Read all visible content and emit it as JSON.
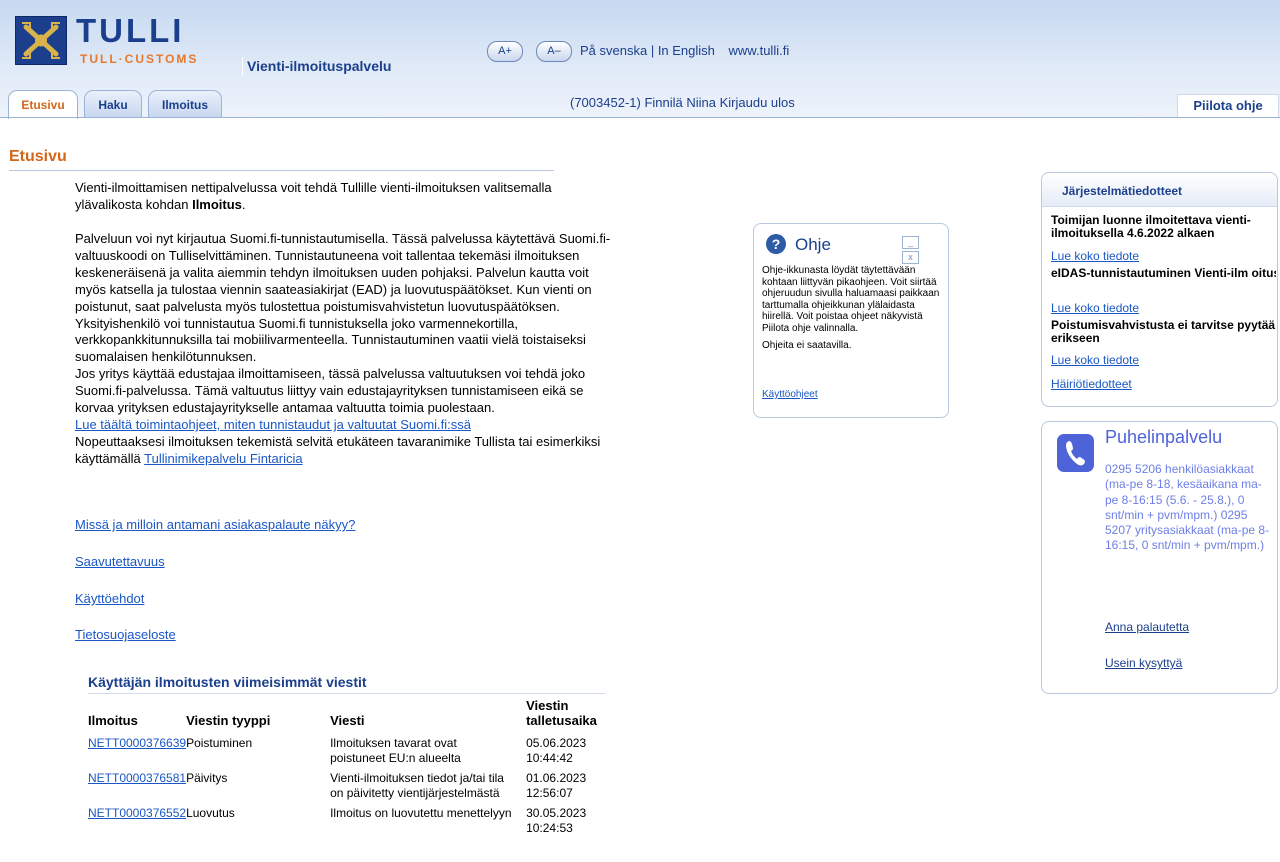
{
  "header": {
    "logo_word": "TULLI",
    "logo_sub": "TULL·CUSTOMS",
    "service_name": "Vienti-ilmoituspalvelu",
    "font_increase": "A+",
    "font_decrease": "A–",
    "lang_swedish": "På svenska",
    "lang_sep": " | ",
    "lang_english": "In English",
    "site_link": "www.tulli.fi",
    "user_info": "(7003452-1) Finnilä Niina",
    "logout": "Kirjaudu ulos",
    "hide_help": "Piilota ohje"
  },
  "tabs": [
    {
      "label": "Etusivu",
      "active": true
    },
    {
      "label": "Haku",
      "active": false
    },
    {
      "label": "Ilmoitus",
      "active": false
    }
  ],
  "main": {
    "title": "Etusivu",
    "intro_text": "Vienti-ilmoittamisen nettipalvelussa voit tehdä Tullille vienti-ilmoituksen valitsemalla ylävalikosta kohdan ",
    "intro_bold": "Ilmoitus",
    "intro_end": ".",
    "para1": "Palveluun voi nyt kirjautua Suomi.fi-tunnistautumisella. Tässä palvelussa käytettävä Suomi.fi-valtuuskoodi on Tulliselvittäminen. Tunnistautuneena voit tallentaa tekemäsi ilmoituksen keskeneräisenä ja valita aiemmin tehdyn ilmoituksen uuden pohjaksi. Palvelun kautta voit myös katsella ja tulostaa viennin saateasiakirjat (EAD) ja luovutuspäätökset. Kun vienti on poistunut, saat palvelusta myös tulostettua poistumisvahvistetun luovutuspäätöksen.",
    "para2": "Yksityishenkilö voi tunnistautua Suomi.fi tunnistuksella joko varmennekortilla, verkkopankkitunnuksilla tai mobiilivarmenteella. Tunnistautuminen vaatii vielä toistaiseksi suomalaisen henkilötunnuksen.",
    "para3": "Jos yritys käyttää edustajaa ilmoittamiseen, tässä palvelussa valtuutuksen voi tehdä joko Suomi.fi-palvelussa. Tämä valtuutus liittyy vain edustajayrityksen tunnistamiseen eikä se korvaa yrityksen edustajayritykselle antamaa valtuutta toimia puolestaan.",
    "link_instructions": "Lue täältä toimintaohjeet, miten tunnistaudut ja valtuutat Suomi.fi:ssä",
    "para4": "Nopeuttaaksesi ilmoituksen tekemistä selvitä etukäteen tavaranimike Tullista tai esimerkiksi käyttämällä ",
    "link_fintaric": "Tullinimikepalvelu Fintaricia",
    "link_feedback_visibility": "Missä ja milloin antamani asiakaspalaute näkyy?",
    "link_accessibility": "Saavutettavuus",
    "link_terms": "Käyttöehdot",
    "link_privacy": "Tietosuojaseloste"
  },
  "messages": {
    "heading": "Käyttäjän ilmoitusten viimeisimmät viestit",
    "columns": [
      "Ilmoitus",
      "Viestin tyyppi",
      "Viesti",
      "Viestin talletusaika"
    ],
    "rows": [
      {
        "id": "NETT0000376639",
        "type": "Poistuminen",
        "msg": "Ilmoituksen tavarat ovat poistuneet EU:n alueelta",
        "time": "05.06.2023 10:44:42"
      },
      {
        "id": "NETT0000376581",
        "type": "Päivitys",
        "msg": "Vienti-ilmoituksen tiedot ja/tai tila on päivitetty vientijärjestelmästä",
        "time": "01.06.2023 12:56:07"
      },
      {
        "id": "NETT0000376552",
        "type": "Luovutus",
        "msg": "Ilmoitus on luovutettu menettelyyn",
        "time": "30.05.2023 10:24:53"
      }
    ]
  },
  "help": {
    "title": "Ohje",
    "text1": "Ohje-ikkunasta löydät täytettävään kohtaan liittyvän pikaohjeen. Voit siirtää ohjeruudun sivulla haluamaasi paikkaan tarttumalla ohjeikkunan ylälaidasta hiirellä. Voit poistaa ohjeet näkyvistä Piilota ohje valinnalla.",
    "text2": "Ohjeita ei saatavilla.",
    "link": "Käyttöohjeet"
  },
  "system_notices": {
    "title": "Järjestelmätiedotteet",
    "items": [
      {
        "title": "Toimijan luonne ilmoitettava vienti-ilmoituksella 4.6.2022 alkaen",
        "link": "Lue koko tiedote"
      },
      {
        "title": "eIDAS-tunnistautuminen Vienti-ilm oituspalvelussa ei vielä mahdollista",
        "link": "Lue koko tiedote"
      },
      {
        "title": "Poistumisvahvistusta ei tarvitse pyytää erikseen",
        "link": "Lue koko tiedote"
      }
    ],
    "disturbance_link": "Häiriötiedotteet"
  },
  "phone": {
    "title": "Puhelinpalvelu",
    "text": "0295 5206 henkilöasiakkaat (ma-pe 8-18, kesäaikana ma-pe 8-16:15 (5.6. - 25.8.), 0 snt/min + pvm/mpm.) 0295 5207 yritysasiakkaat (ma-pe 8-16:15, 0 snt/min + pvm/mpm.)",
    "feedback": "Anna palautetta",
    "faq": "Usein kysyttyä"
  },
  "colors": {
    "brand": "#1b3f8c",
    "accent": "#d4661a",
    "link": "#1a57c6",
    "phone": "#4f63d9"
  }
}
